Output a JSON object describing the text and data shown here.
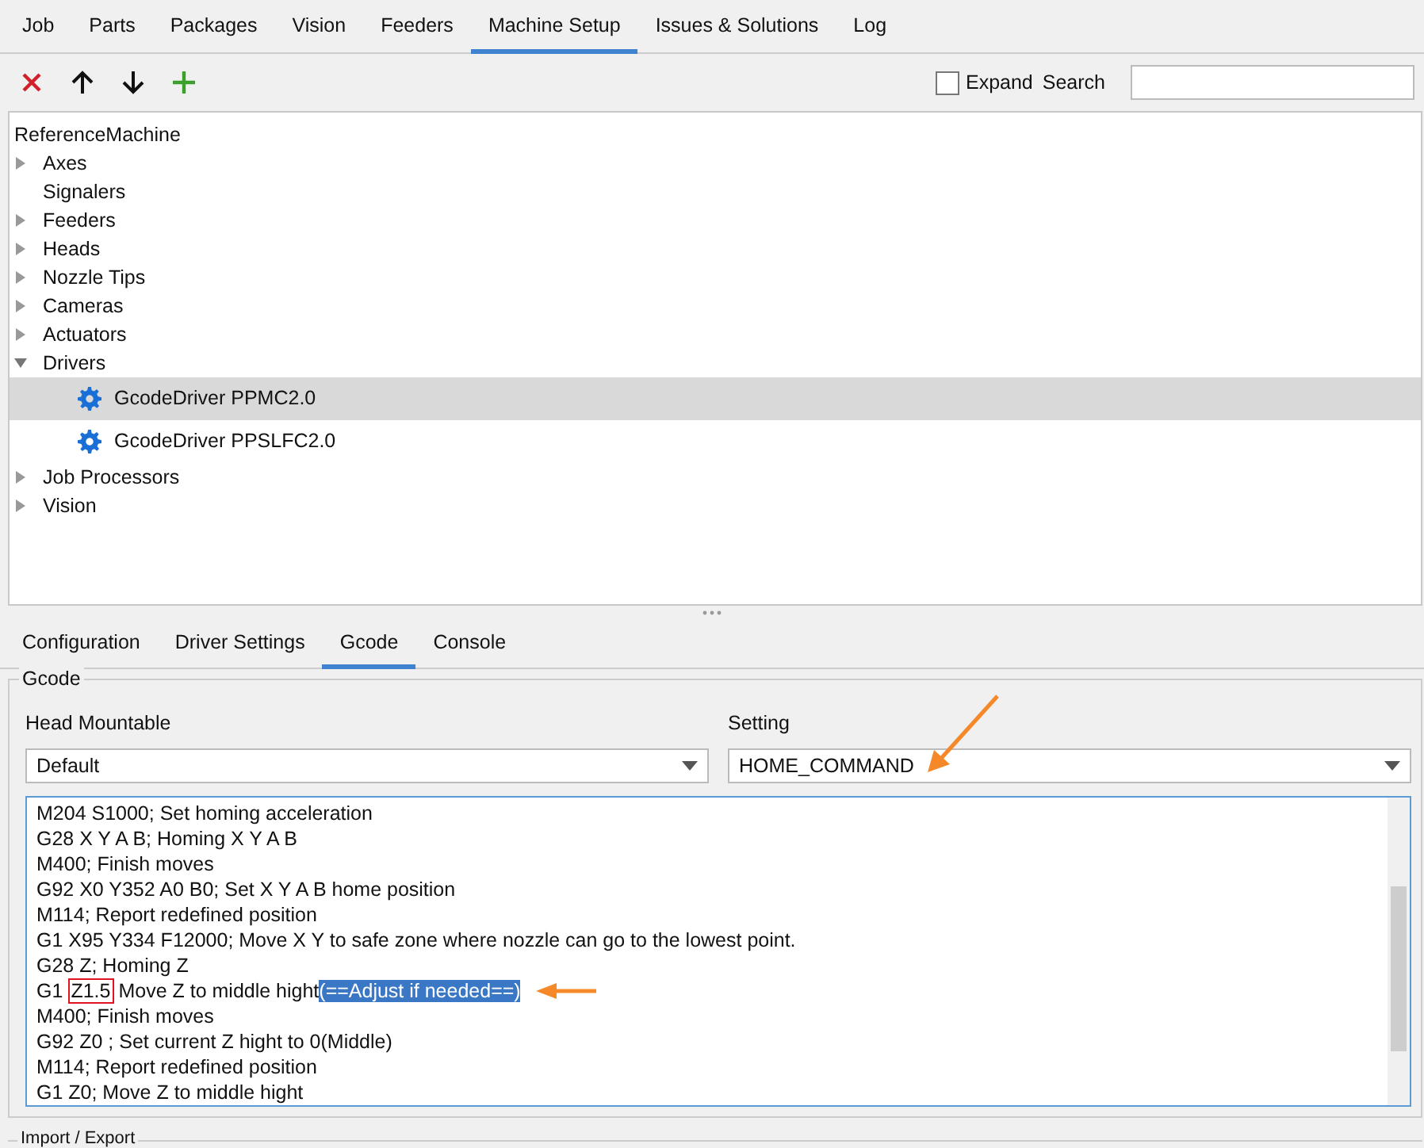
{
  "tabs": [
    {
      "label": "Job",
      "selected": false
    },
    {
      "label": "Parts",
      "selected": false
    },
    {
      "label": "Packages",
      "selected": false
    },
    {
      "label": "Vision",
      "selected": false
    },
    {
      "label": "Feeders",
      "selected": false
    },
    {
      "label": "Machine Setup",
      "selected": true
    },
    {
      "label": "Issues & Solutions",
      "selected": false
    },
    {
      "label": "Log",
      "selected": false
    }
  ],
  "toolbar": {
    "buttons": [
      {
        "kind": "delete"
      },
      {
        "kind": "up"
      },
      {
        "kind": "down"
      },
      {
        "kind": "add"
      }
    ],
    "expand": {
      "label": "Expand",
      "checked": false
    },
    "search": {
      "label": "Search"
    }
  },
  "tree": {
    "root": "ReferenceMachine",
    "items": [
      {
        "label": "Axes",
        "expanded": false
      },
      {
        "label": "Signalers"
      },
      {
        "label": "Feeders",
        "expanded": false
      },
      {
        "label": "Heads",
        "expanded": false
      },
      {
        "label": "Nozzle Tips",
        "expanded": false
      },
      {
        "label": "Cameras",
        "expanded": false
      },
      {
        "label": "Actuators",
        "expanded": false
      },
      {
        "label": "Drivers",
        "expanded": true,
        "children": [
          {
            "label": "GcodeDriver PPMC2.0",
            "selected": true
          },
          {
            "label": "GcodeDriver PPSLFC2.0",
            "selected": false
          }
        ]
      },
      {
        "label": "Job Processors",
        "expanded": false
      },
      {
        "label": "Vision",
        "expanded": false
      }
    ]
  },
  "detail_tabs": [
    {
      "label": "Configuration",
      "selected": false
    },
    {
      "label": "Driver Settings",
      "selected": false
    },
    {
      "label": "Gcode",
      "selected": true
    },
    {
      "label": "Console",
      "selected": false
    }
  ],
  "gcode": {
    "title": "Gcode",
    "head_mountable": {
      "label": "Head Mountable",
      "value": "Default"
    },
    "setting": {
      "label": "Setting",
      "value": "HOME_COMMAND"
    },
    "lines": [
      {
        "parts": [
          {
            "text": "M204 S1000; Set homing acceleration",
            "kind": "plain"
          }
        ]
      },
      {
        "parts": [
          {
            "text": "G28 X Y A B; Homing X Y A B",
            "kind": "plain"
          }
        ]
      },
      {
        "parts": [
          {
            "text": "M400; Finish moves",
            "kind": "plain"
          }
        ]
      },
      {
        "parts": [
          {
            "text": "G92 X0 Y352 A0 B0; Set X Y A B home position",
            "kind": "plain"
          }
        ]
      },
      {
        "parts": [
          {
            "text": "M114; Report redefined position",
            "kind": "plain"
          }
        ]
      },
      {
        "parts": [
          {
            "text": "G1 X95 Y334 F12000; Move X Y to safe zone where nozzle can go to the lowest point.",
            "kind": "plain"
          }
        ]
      },
      {
        "parts": [
          {
            "text": "G28 Z; Homing Z",
            "kind": "plain"
          }
        ]
      },
      {
        "parts": [
          {
            "text": "G1",
            "kind": "plain"
          },
          {
            "text": "Z1.5",
            "kind": "boxed"
          },
          {
            "text": "Move Z to middle hight",
            "kind": "plain"
          },
          {
            "text": "(==Adjust if needed==)",
            "kind": "selected"
          }
        ],
        "arrow": true
      },
      {
        "parts": [
          {
            "text": "M400; Finish moves",
            "kind": "plain"
          }
        ]
      },
      {
        "parts": [
          {
            "text": "G92 Z0 ; Set current Z hight to 0(Middle)",
            "kind": "plain"
          }
        ]
      },
      {
        "parts": [
          {
            "text": "M114; Report redefined position",
            "kind": "plain"
          }
        ]
      },
      {
        "parts": [
          {
            "text": "G1 Z0; Move Z to middle hight",
            "kind": "plain"
          }
        ]
      }
    ]
  },
  "import_export": {
    "title": "Import / Export"
  }
}
